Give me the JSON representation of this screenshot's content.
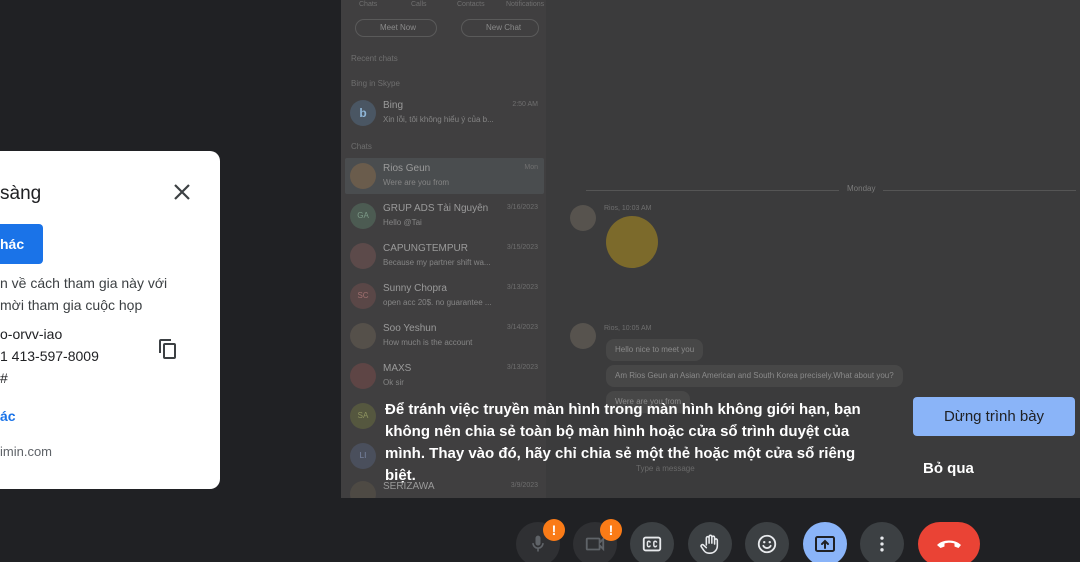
{
  "meeting_card": {
    "title": "sàng",
    "share_button": "hác",
    "desc_line1": "n về cách tham gia này với",
    "desc_line2": "mời tham gia cuộc họp",
    "meeting_code": "o-orvv-iao",
    "phone": "1 413-597-8009",
    "pin": "#",
    "more_link": "ác",
    "joined_as": "imin.com"
  },
  "shared_screen": {
    "tabs": [
      "Chats",
      "Calls",
      "Contacts",
      "Notifications"
    ],
    "meet_now": "Meet Now",
    "new_chat": "New Chat",
    "recent_chats": "Recent chats",
    "bing_section": "Bing in Skype",
    "chats_section": "Chats",
    "chats": [
      {
        "name": "Bing",
        "preview": "Xin lỗi, tôi không hiểu ý của b...",
        "time": "2:50 AM",
        "initials": "b"
      },
      {
        "name": "Rios Geun",
        "preview": "Were are you from",
        "time": "Mon",
        "initials": ""
      },
      {
        "name": "GRUP ADS Tài Nguyên",
        "preview": "Hello @Tai",
        "time": "3/16/2023",
        "initials": "GA"
      },
      {
        "name": "CAPUNGTEMPUR",
        "preview": "Because my partner shift wa...",
        "time": "3/15/2023",
        "initials": ""
      },
      {
        "name": "Sunny Chopra",
        "preview": "open acc 20$. no guarantee ...",
        "time": "3/13/2023",
        "initials": "SC"
      },
      {
        "name": "Soo Yeshun",
        "preview": "How much is the account",
        "time": "3/14/2023",
        "initials": ""
      },
      {
        "name": "MAXS",
        "preview": "Ok sir",
        "time": "3/13/2023",
        "initials": ""
      },
      {
        "name": "",
        "preview": "",
        "time": "",
        "initials": "SA"
      },
      {
        "name": "",
        "preview": "",
        "time": "",
        "initials": "LI"
      },
      {
        "name": "SERIZAWA",
        "preview": "",
        "time": "3/9/2023",
        "initials": ""
      }
    ],
    "day_divider": "Monday",
    "msg1_meta": "Rios, 10:03 AM",
    "msg2_meta": "Rios, 10:05 AM",
    "messages": [
      "Hello nice to meet you",
      "Am Rios Geun an Asian American and South Korea precisely.What about you?",
      "Were are you from"
    ],
    "input_placeholder": "Type a message"
  },
  "warning": {
    "text": "Để tránh việc truyền màn hình trong màn hình không giới hạn, bạn không nên chia sẻ toàn bộ màn hình hoặc cửa sổ trình duyệt của mình. Thay vào đó, hãy chỉ chia sẻ một thẻ hoặc một cửa sổ riêng biệt.",
    "stop_button": "Dừng trình bày",
    "skip_button": "Bỏ qua"
  },
  "controls": {
    "mic_badge": "!",
    "camera_badge": "!"
  },
  "colors": {
    "accent": "#8ab4f8",
    "brand_blue": "#1a73e8",
    "end_call": "#ea4335",
    "warning_badge": "#fa7b17"
  }
}
